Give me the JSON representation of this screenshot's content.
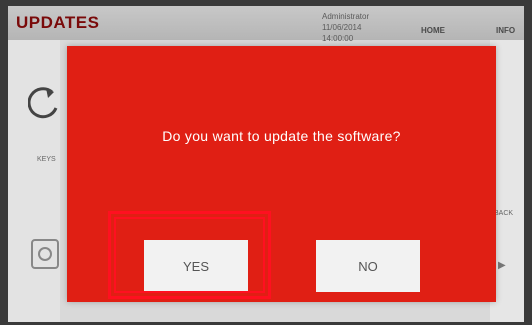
{
  "app": {
    "title": "UPDATES",
    "user": "Administrator",
    "date": "11/06/2014",
    "time": "14:00:00"
  },
  "nav": {
    "home_label": "HOME",
    "info_label": "INFO"
  },
  "sidebar": {
    "keys_label": "KEYS",
    "back_label": "BACK"
  },
  "dialog": {
    "question": "Do you want to update the software?",
    "yes_label": "YES",
    "no_label": "NO",
    "background_color": "#e01f14",
    "highlighted_button": "YES",
    "highlight_color": "#ff1020"
  }
}
